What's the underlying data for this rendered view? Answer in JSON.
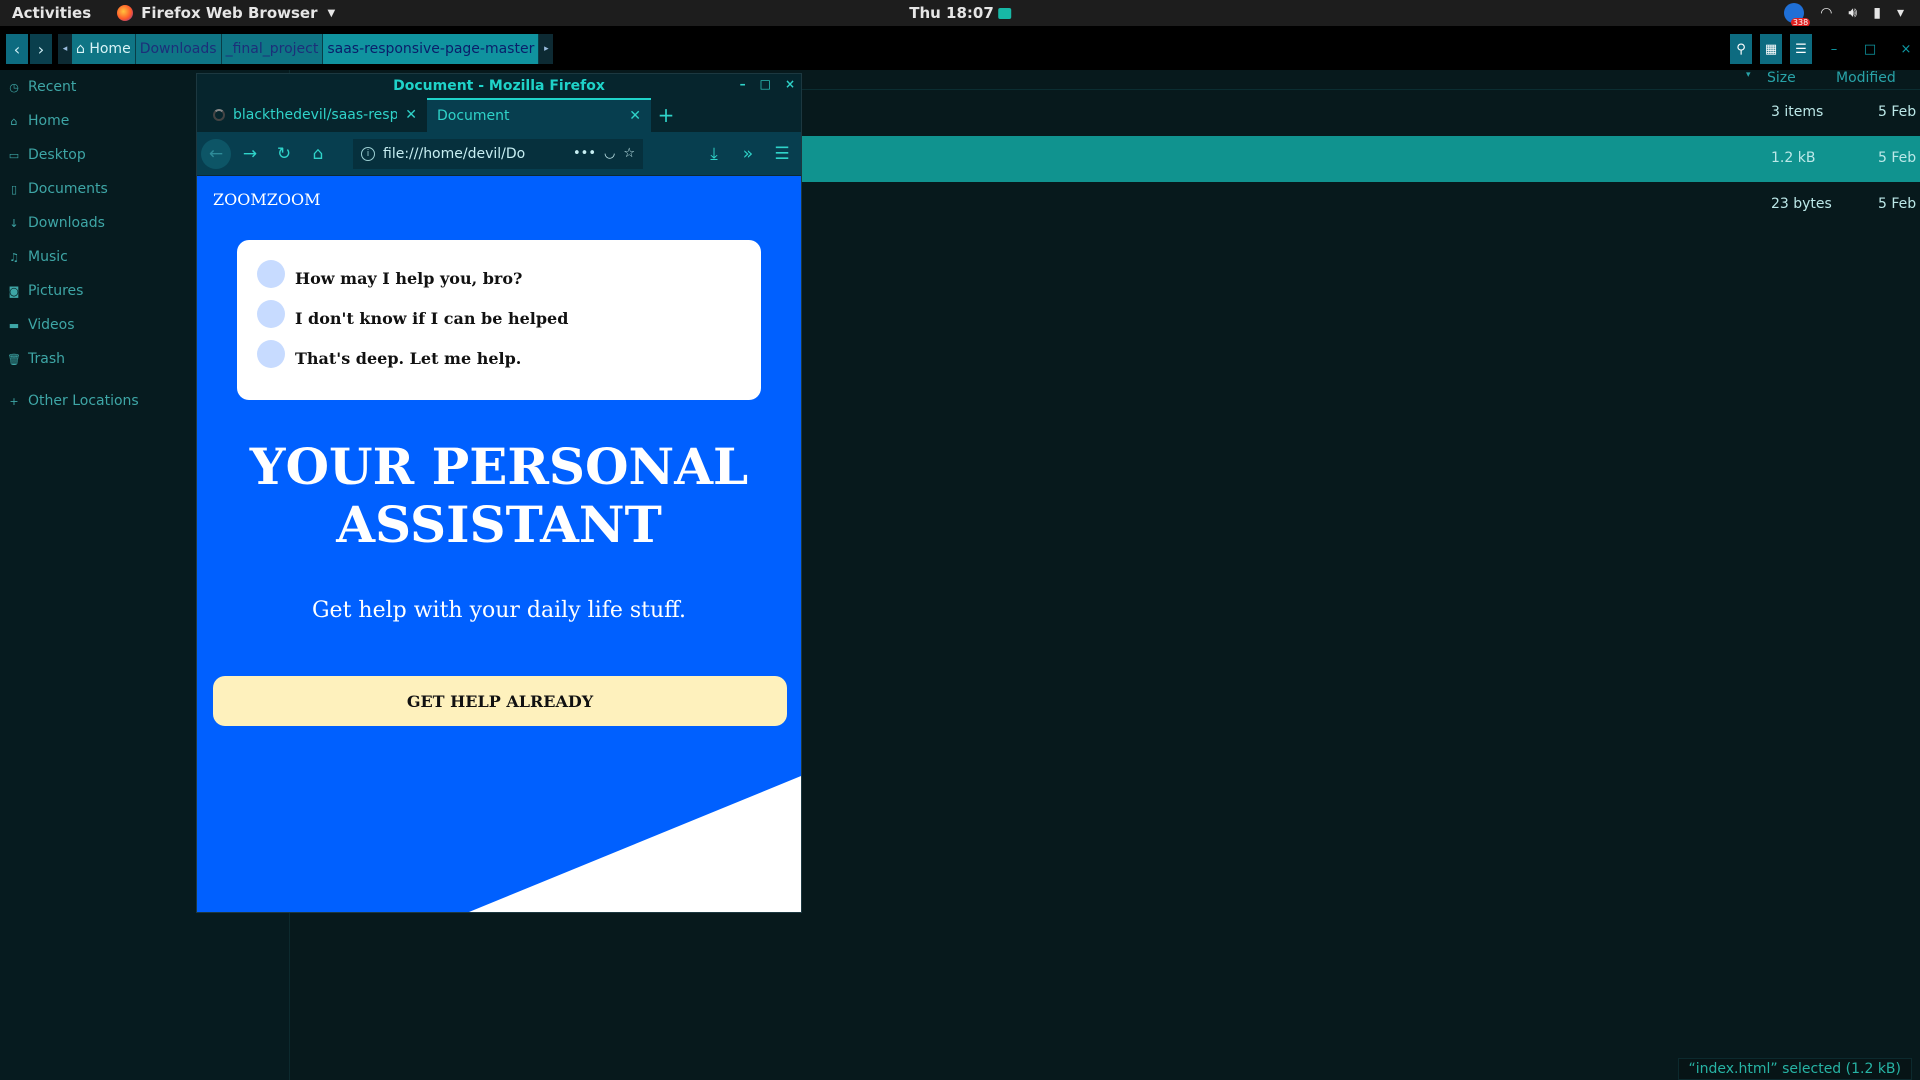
{
  "topbar": {
    "activities": "Activities",
    "app_name": "Firefox Web Browser",
    "clock": "Thu 18:07",
    "notif_count": "338"
  },
  "filemanager": {
    "breadcrumbs": [
      {
        "label": "Home"
      },
      {
        "label": "Downloads"
      },
      {
        "label": "_final_project"
      },
      {
        "label": "saas-responsive-page-master"
      }
    ],
    "sidebar": [
      {
        "icon": "clock-icon",
        "label": "Recent"
      },
      {
        "icon": "home-icon",
        "label": "Home"
      },
      {
        "icon": "folder-icon",
        "label": "Desktop"
      },
      {
        "icon": "document-icon",
        "label": "Documents"
      },
      {
        "icon": "download-icon",
        "label": "Downloads"
      },
      {
        "icon": "music-icon",
        "label": "Music"
      },
      {
        "icon": "camera-icon",
        "label": "Pictures"
      },
      {
        "icon": "video-icon",
        "label": "Videos"
      },
      {
        "icon": "trash-icon",
        "label": "Trash"
      },
      {
        "icon": "plus-icon",
        "label": "Other Locations"
      }
    ],
    "columns": {
      "size": "Size",
      "modified": "Modified"
    },
    "rows": [
      {
        "size": "3 items",
        "modified": "5 Feb",
        "selected": false
      },
      {
        "size": "1.2 kB",
        "modified": "5 Feb",
        "selected": true
      },
      {
        "size": "23 bytes",
        "modified": "5 Feb",
        "selected": false
      }
    ],
    "status": "“index.html” selected  (1.2 kB)"
  },
  "firefox": {
    "window_title": "Document - Mozilla Firefox",
    "tabs": [
      {
        "label": "blackthedevil/saas-respo",
        "active": false
      },
      {
        "label": "Document",
        "active": true
      }
    ],
    "url": "file:///home/devil/Do",
    "page": {
      "logo": "ZOOMZOOM",
      "messages": [
        "How may I help you, bro?",
        "I don't know if I can be helped",
        "That's deep. Let me help."
      ],
      "hero_line1": "YOUR PERSONAL",
      "hero_line2": "ASSISTANT",
      "subtitle": "Get help with your daily life stuff.",
      "cta": "GET HELP ALREADY"
    }
  },
  "colors": {
    "accent": "#1fd3c9",
    "page_blue": "#0060ff",
    "cta_bg": "#fef1bd",
    "selection": "#10938f"
  }
}
